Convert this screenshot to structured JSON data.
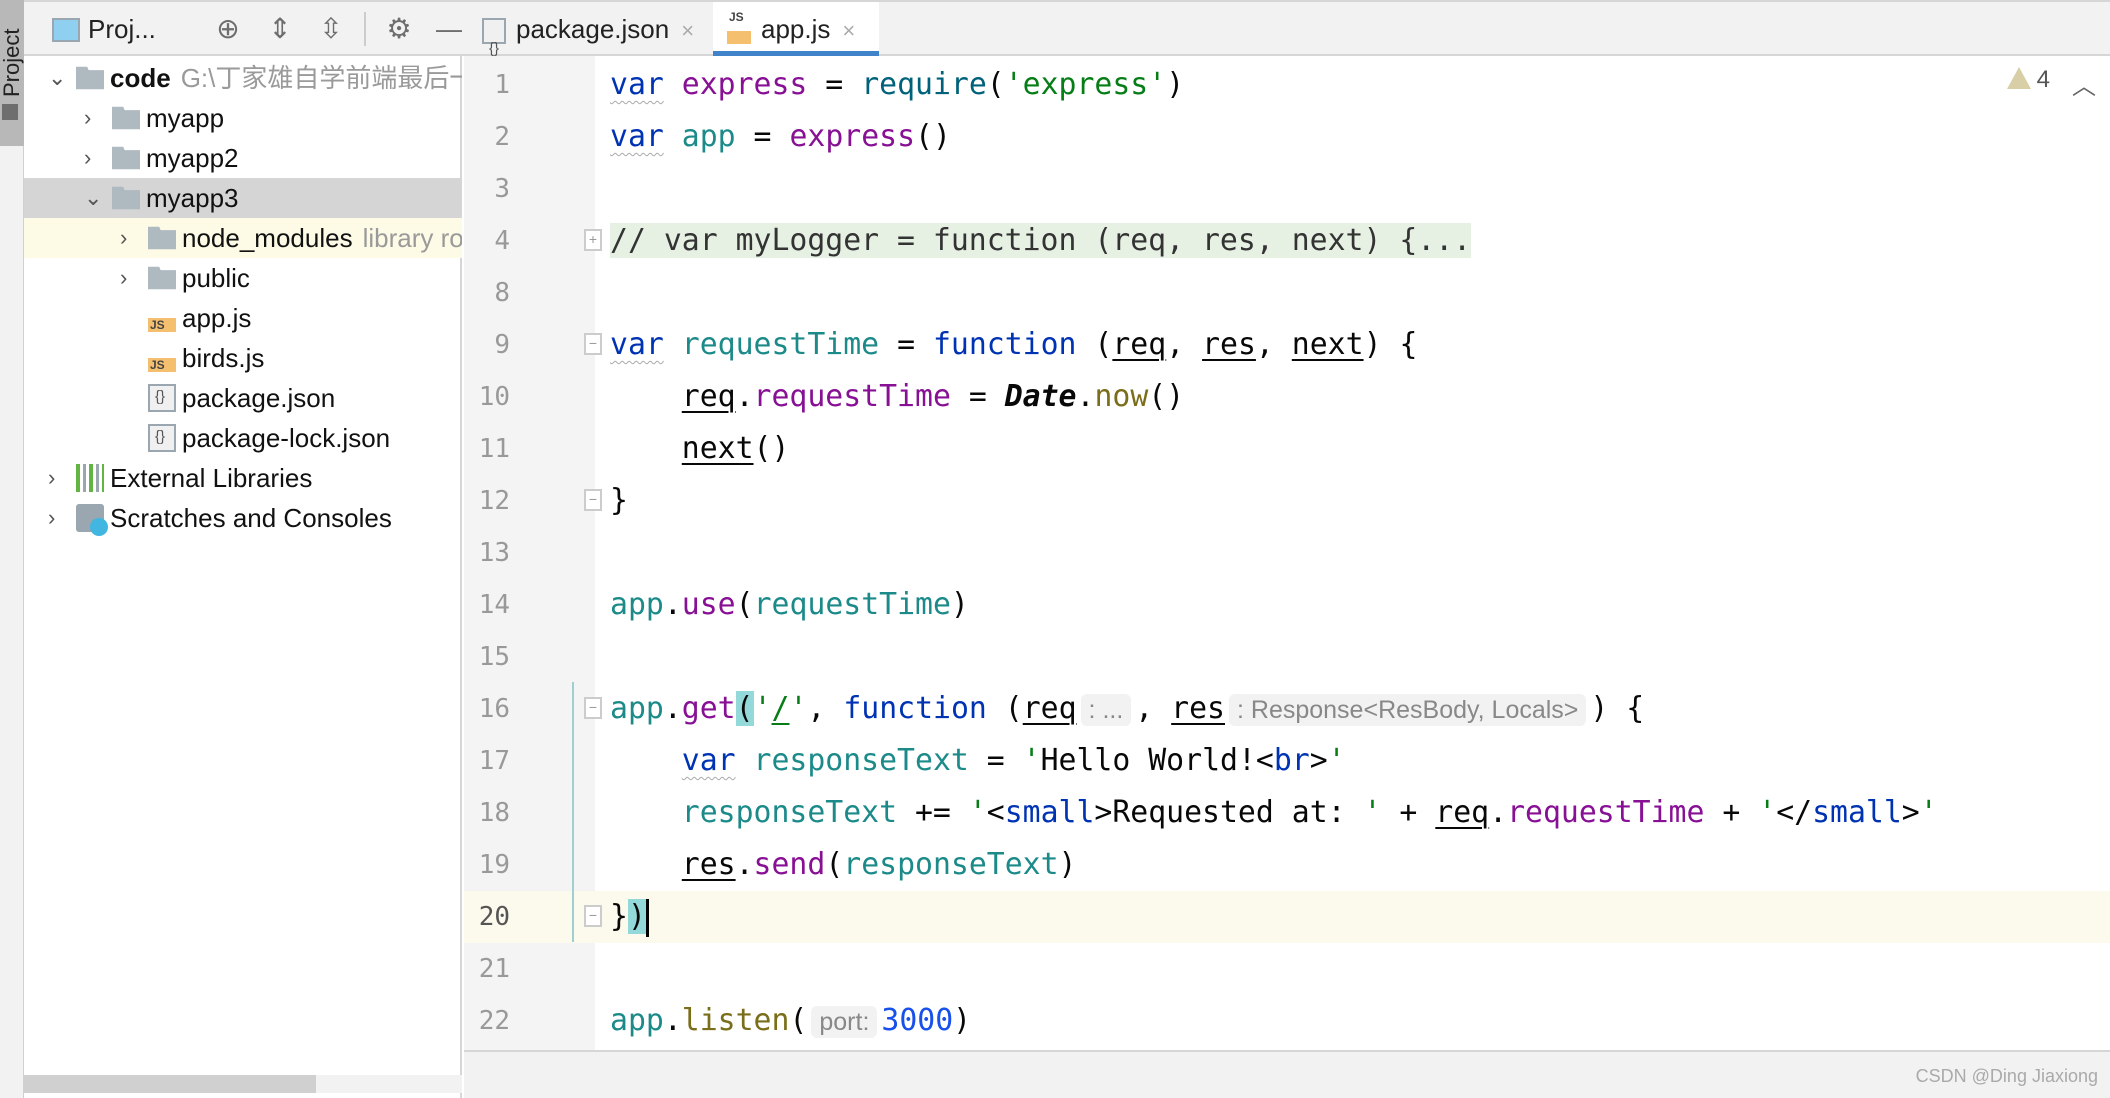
{
  "sidebar_strip": {
    "label": "Project"
  },
  "project_panel": {
    "title": "Proj...",
    "toolbar_icons": [
      "locate-icon",
      "expand-all-icon",
      "collapse-all-icon",
      "gear-icon",
      "minimize-icon"
    ],
    "tree": [
      {
        "level": 0,
        "arrow": "down",
        "icon": "folder",
        "label": "code",
        "bold": true,
        "hint": "G:\\丁家雄自学前端最后一"
      },
      {
        "level": 1,
        "arrow": "right",
        "icon": "folder",
        "label": "myapp"
      },
      {
        "level": 1,
        "arrow": "right",
        "icon": "folder",
        "label": "myapp2"
      },
      {
        "level": 1,
        "arrow": "down",
        "icon": "folder",
        "label": "myapp3",
        "selected": true
      },
      {
        "level": 2,
        "arrow": "right",
        "icon": "folder",
        "label": "node_modules",
        "hint": "library ro",
        "library": true
      },
      {
        "level": 2,
        "arrow": "right",
        "icon": "folder",
        "label": "public"
      },
      {
        "level": 2,
        "arrow": "",
        "icon": "js",
        "label": "app.js"
      },
      {
        "level": 2,
        "arrow": "",
        "icon": "js",
        "label": "birds.js"
      },
      {
        "level": 2,
        "arrow": "",
        "icon": "json",
        "label": "package.json"
      },
      {
        "level": 2,
        "arrow": "",
        "icon": "json",
        "label": "package-lock.json"
      },
      {
        "level": 0,
        "arrow": "right",
        "icon": "lib",
        "label": "External Libraries"
      },
      {
        "level": 0,
        "arrow": "right",
        "icon": "scratch",
        "label": "Scratches and Consoles"
      }
    ]
  },
  "tabs": [
    {
      "label": "package.json",
      "icon": "json",
      "active": false
    },
    {
      "label": "app.js",
      "icon": "js",
      "active": true
    }
  ],
  "close_glyph": "×",
  "editor": {
    "warnings": "4",
    "current_line": "20",
    "lines": [
      {
        "n": "1",
        "t": [
          [
            "kw wavy",
            "var"
          ],
          [
            "",
            " "
          ],
          [
            "gv",
            "express"
          ],
          [
            "",
            " = "
          ],
          [
            "fn",
            "require"
          ],
          [
            "",
            "("
          ],
          [
            "str",
            "'express'"
          ],
          [
            "",
            ")"
          ]
        ]
      },
      {
        "n": "2",
        "t": [
          [
            "kw wavy",
            "var"
          ],
          [
            "",
            " "
          ],
          [
            "lv",
            "app"
          ],
          [
            "",
            " = "
          ],
          [
            "gv",
            "express"
          ],
          [
            "",
            "()"
          ]
        ]
      },
      {
        "n": "3",
        "t": []
      },
      {
        "n": "4",
        "fold": "+",
        "t": [
          [
            "fold-bg",
            "// var myLogger = function (req, res, next) {..."
          ]
        ]
      },
      {
        "n": "8",
        "t": []
      },
      {
        "n": "9",
        "fold": "-",
        "t": [
          [
            "kw wavy",
            "var"
          ],
          [
            "",
            " "
          ],
          [
            "lv",
            "requestTime"
          ],
          [
            "",
            " = "
          ],
          [
            "kw",
            "function"
          ],
          [
            "",
            " ("
          ],
          [
            "ul",
            "req"
          ],
          [
            "",
            ", "
          ],
          [
            "ul",
            "res"
          ],
          [
            "",
            ", "
          ],
          [
            "ul",
            "next"
          ],
          [
            "",
            ") {"
          ]
        ]
      },
      {
        "n": "10",
        "t": [
          [
            "",
            "    "
          ],
          [
            "ul",
            "req"
          ],
          [
            "",
            "."
          ],
          [
            "gv",
            "requestTime"
          ],
          [
            "",
            " = "
          ],
          [
            "dt",
            "Date"
          ],
          [
            "",
            "."
          ],
          [
            "ol",
            "now"
          ],
          [
            "",
            "()"
          ]
        ]
      },
      {
        "n": "11",
        "t": [
          [
            "",
            "    "
          ],
          [
            "ul",
            "next"
          ],
          [
            "",
            "()"
          ]
        ]
      },
      {
        "n": "12",
        "fold": "-",
        "t": [
          [
            "",
            "}"
          ]
        ]
      },
      {
        "n": "13",
        "t": []
      },
      {
        "n": "14",
        "t": [
          [
            "lv",
            "app"
          ],
          [
            "",
            "."
          ],
          [
            "gv",
            "use"
          ],
          [
            "",
            "("
          ],
          [
            "lv",
            "requestTime"
          ],
          [
            "",
            ")"
          ]
        ]
      },
      {
        "n": "15",
        "t": []
      },
      {
        "n": "16",
        "fold": "-",
        "t": [
          [
            "lv",
            "app"
          ],
          [
            "",
            "."
          ],
          [
            "gv",
            "get"
          ],
          [
            "brace",
            "("
          ],
          [
            "str",
            "'"
          ],
          [
            "str ul",
            "/"
          ],
          [
            "str",
            "'"
          ],
          [
            "",
            ", "
          ],
          [
            "kw",
            "function"
          ],
          [
            "",
            " ("
          ],
          [
            "ul",
            "req"
          ],
          [
            "hint",
            ": ..."
          ],
          [
            "",
            ", "
          ],
          [
            "ul",
            "res"
          ],
          [
            "hint",
            ": Response<ResBody, Locals>"
          ],
          [
            "",
            ") {"
          ]
        ]
      },
      {
        "n": "17",
        "t": [
          [
            "",
            "    "
          ],
          [
            "kw wavy",
            "var"
          ],
          [
            "",
            " "
          ],
          [
            "lv",
            "responseText"
          ],
          [
            "",
            " = "
          ],
          [
            "str",
            "'"
          ],
          [
            "",
            "Hello World!<"
          ],
          [
            "tag",
            "br"
          ],
          [
            "",
            ">"
          ],
          [
            "str",
            "'"
          ]
        ]
      },
      {
        "n": "18",
        "t": [
          [
            "",
            "    "
          ],
          [
            "lv",
            "responseText"
          ],
          [
            "",
            " += "
          ],
          [
            "str",
            "'"
          ],
          [
            "",
            "<"
          ],
          [
            "tag",
            "small"
          ],
          [
            "",
            ">Requested at: "
          ],
          [
            "str",
            "'"
          ],
          [
            "",
            " + "
          ],
          [
            "ul",
            "req"
          ],
          [
            "",
            "."
          ],
          [
            "gv",
            "requestTime"
          ],
          [
            "",
            " + "
          ],
          [
            "str",
            "'"
          ],
          [
            "",
            "</"
          ],
          [
            "tag",
            "small"
          ],
          [
            "",
            ">"
          ],
          [
            "str",
            "'"
          ]
        ]
      },
      {
        "n": "19",
        "t": [
          [
            "",
            "    "
          ],
          [
            "ul",
            "res"
          ],
          [
            "",
            "."
          ],
          [
            "gv",
            "send"
          ],
          [
            "",
            "("
          ],
          [
            "lv",
            "responseText"
          ],
          [
            "",
            ")"
          ]
        ]
      },
      {
        "n": "20",
        "fold": "-",
        "t": [
          [
            "",
            "}"
          ],
          [
            "brace",
            ")"
          ],
          [
            "caret",
            ""
          ]
        ]
      },
      {
        "n": "21",
        "t": []
      },
      {
        "n": "22",
        "t": [
          [
            "lv",
            "app"
          ],
          [
            "",
            "."
          ],
          [
            "ol",
            "listen"
          ],
          [
            "",
            "("
          ],
          [
            "hint",
            "port:"
          ],
          [
            "num",
            "3000"
          ],
          [
            "",
            ")"
          ]
        ]
      }
    ]
  },
  "watermark": "CSDN @Ding Jiaxiong",
  "colors": {
    "keyword": "#0033b3",
    "global": "#871094",
    "local": "#1d8a8a",
    "string": "#067d17",
    "number": "#1750eb",
    "tab_accent": "#4083c9",
    "current_line": "#fcfaed"
  }
}
